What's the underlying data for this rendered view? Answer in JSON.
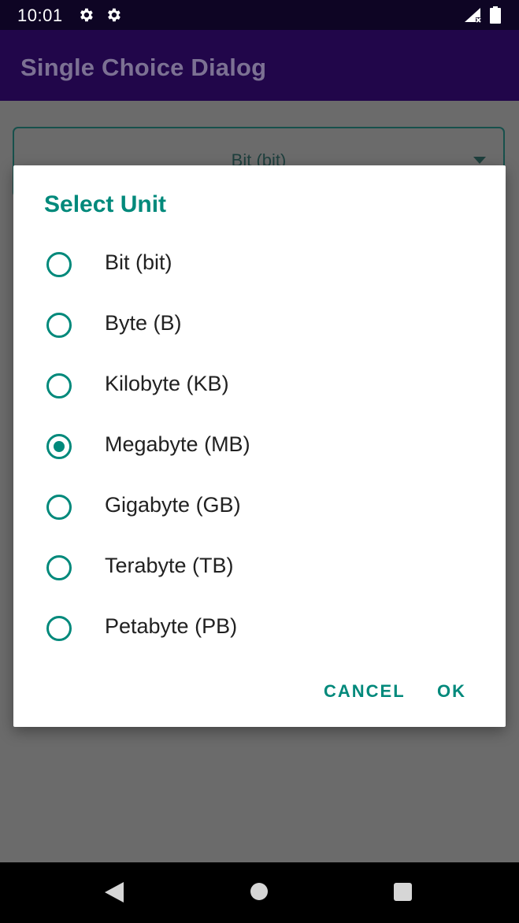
{
  "status_bar": {
    "time": "10:01",
    "icons": [
      "settings-gear-icon",
      "settings-gear-icon",
      "signal-no-service-icon",
      "battery-full-icon"
    ]
  },
  "app_bar": {
    "title": "Single Choice Dialog",
    "color": "#21064a"
  },
  "spinner": {
    "selected_value": "Bit (bit)"
  },
  "dialog": {
    "title": "Select Unit",
    "accent_color": "#00897b",
    "options": [
      {
        "label": "Bit (bit)",
        "selected": false
      },
      {
        "label": "Byte (B)",
        "selected": false
      },
      {
        "label": "Kilobyte (KB)",
        "selected": false
      },
      {
        "label": "Megabyte (MB)",
        "selected": true
      },
      {
        "label": "Gigabyte (GB)",
        "selected": false
      },
      {
        "label": "Terabyte (TB)",
        "selected": false
      },
      {
        "label": "Petabyte (PB)",
        "selected": false
      }
    ],
    "cancel_label": "CANCEL",
    "ok_label": "OK"
  },
  "nav_bar": {
    "icons": [
      "back-icon",
      "home-icon",
      "recents-icon"
    ]
  }
}
